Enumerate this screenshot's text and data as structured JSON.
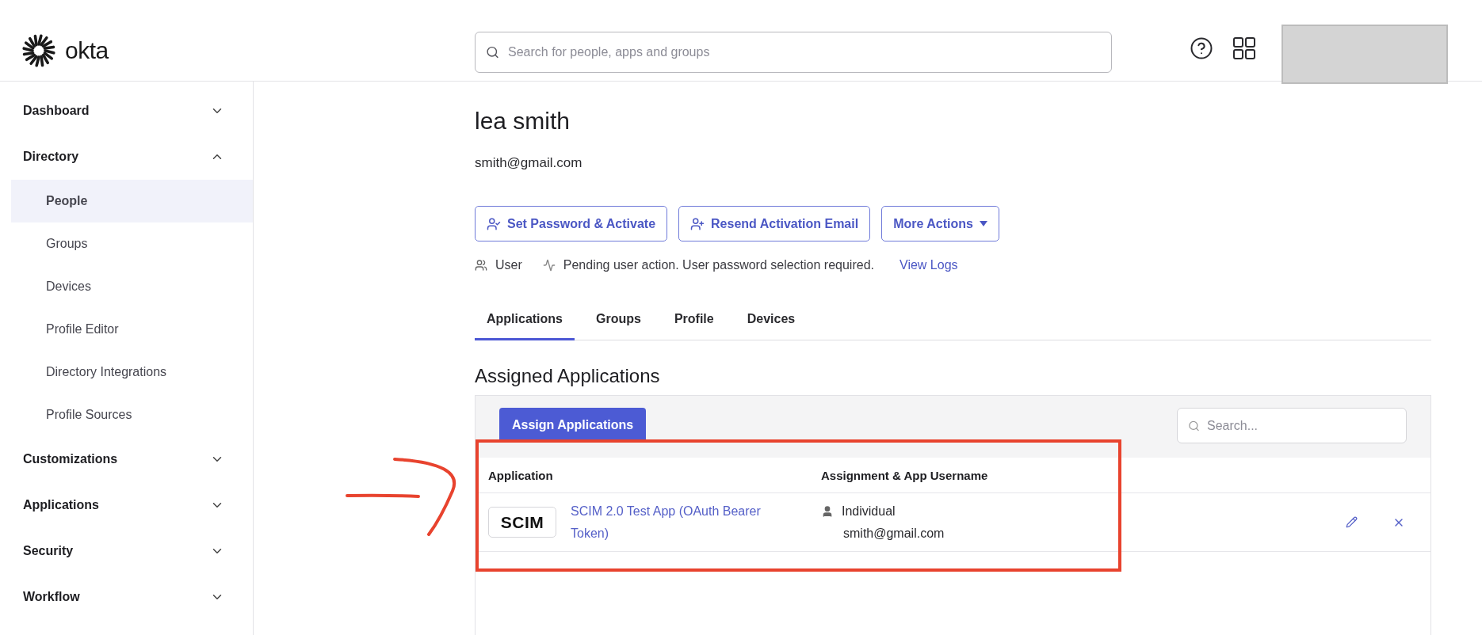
{
  "header": {
    "logo_text": "okta",
    "search": {
      "placeholder": "Search for people, apps and groups"
    }
  },
  "sidebar": {
    "items": [
      {
        "label": "Dashboard",
        "expanded": false
      },
      {
        "label": "Directory",
        "expanded": true,
        "children": [
          {
            "label": "People",
            "selected": true
          },
          {
            "label": "Groups",
            "selected": false
          },
          {
            "label": "Devices",
            "selected": false
          },
          {
            "label": "Profile Editor",
            "selected": false
          },
          {
            "label": "Directory Integrations",
            "selected": false
          },
          {
            "label": "Profile Sources",
            "selected": false
          }
        ]
      },
      {
        "label": "Customizations",
        "expanded": false
      },
      {
        "label": "Applications",
        "expanded": false
      },
      {
        "label": "Security",
        "expanded": false
      },
      {
        "label": "Workflow",
        "expanded": false
      }
    ]
  },
  "user": {
    "name": "lea smith",
    "email": "smith@gmail.com"
  },
  "actions": [
    {
      "label": "Set Password & Activate",
      "kind": "set-password"
    },
    {
      "label": "Resend Activation Email",
      "kind": "resend"
    },
    {
      "label": "More Actions",
      "kind": "menu"
    }
  ],
  "status": {
    "role": "User",
    "message": "Pending user action. User password selection required.",
    "link": "View Logs"
  },
  "tabs": [
    {
      "label": "Applications",
      "selected": true
    },
    {
      "label": "Groups",
      "selected": false
    },
    {
      "label": "Profile",
      "selected": false
    },
    {
      "label": "Devices",
      "selected": false
    }
  ],
  "section_title": "Assigned Applications",
  "assign_button": "Assign Applications",
  "table_search": {
    "placeholder": "Search..."
  },
  "table": {
    "columns": [
      "Application",
      "Assignment & App Username"
    ],
    "rows": [
      {
        "logo": "SCIM",
        "app": "SCIM 2.0 Test App (OAuth Bearer Token)",
        "assignment": "Individual",
        "username": "smith@gmail.com"
      }
    ]
  }
}
